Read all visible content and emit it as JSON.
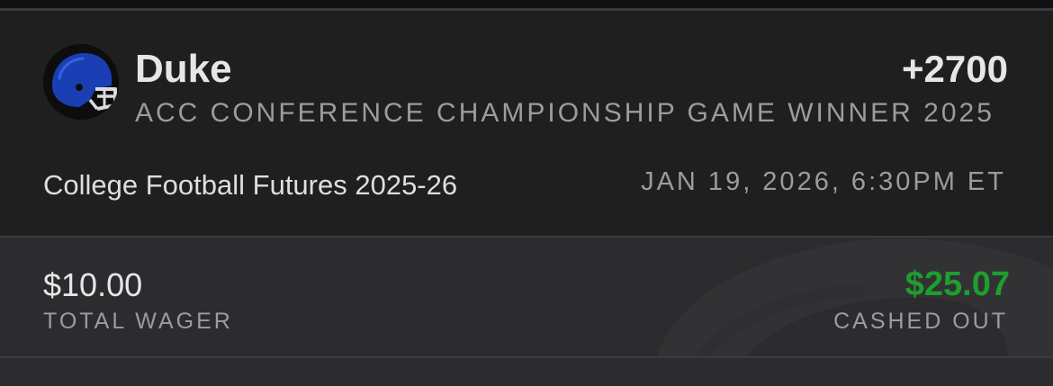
{
  "bet": {
    "team": "Duke",
    "odds": "+2700",
    "market": "ACC CONFERENCE CHAMPIONSHIP GAME WINNER 2025",
    "event": "College Football Futures 2025-26",
    "date": "JAN 19, 2026, 6:30PM ET",
    "logo_icon": "football-helmet-icon"
  },
  "wager": {
    "amount": "$10.00",
    "label": "TOTAL WAGER"
  },
  "payout": {
    "amount": "$25.07",
    "label": "CASHED OUT",
    "color": "#1e9e2e"
  },
  "colors": {
    "background": "#1f1f20",
    "panel": "#2c2c2e",
    "primary_text": "#e6e6e8",
    "secondary_text": "#9a9ca1",
    "duke_blue": "#1a3fb5"
  }
}
